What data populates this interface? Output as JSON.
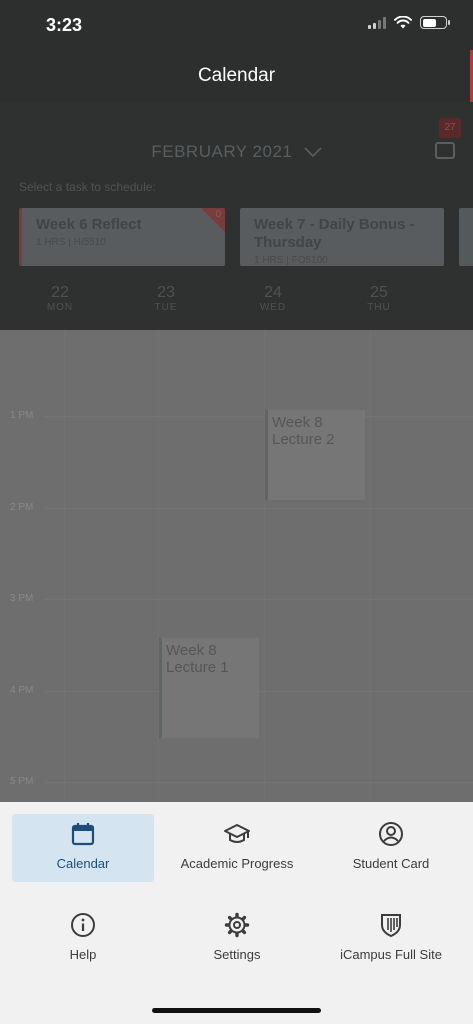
{
  "status_bar": {
    "time": "3:23"
  },
  "header": {
    "title": "Calendar"
  },
  "calendar": {
    "month": "FEBRUARY 2021",
    "badge": "27",
    "task_prompt": "Select a task to schedule:",
    "tasks": [
      {
        "title": "Week 6 Reflect",
        "meta": "1 HRS | HI5510",
        "flag": "0"
      },
      {
        "title": "Week 7 - Daily Bonus - Thursday",
        "meta": "1 HRS | FO5100"
      }
    ],
    "days": [
      {
        "num": "22",
        "name": "MON"
      },
      {
        "num": "23",
        "name": "TUE"
      },
      {
        "num": "24",
        "name": "WED"
      },
      {
        "num": "25",
        "name": "THU"
      }
    ],
    "hours": [
      "1 PM",
      "2 PM",
      "3 PM",
      "4 PM",
      "5 PM"
    ],
    "events": [
      {
        "title": "Week 8 Lecture 2"
      },
      {
        "title": "Week 8 Lecture 1"
      }
    ]
  },
  "menu": {
    "items": [
      {
        "label": "Calendar",
        "icon": "calendar-icon",
        "active": true
      },
      {
        "label": "Academic Progress",
        "icon": "graduation-cap-icon"
      },
      {
        "label": "Student Card",
        "icon": "user-circle-icon"
      },
      {
        "label": "Help",
        "icon": "info-icon"
      },
      {
        "label": "Settings",
        "icon": "gear-icon"
      },
      {
        "label": "iCampus Full Site",
        "icon": "shield-icon"
      }
    ],
    "accent": "#1f4d7a",
    "active_bg": "#d4e5f1"
  }
}
